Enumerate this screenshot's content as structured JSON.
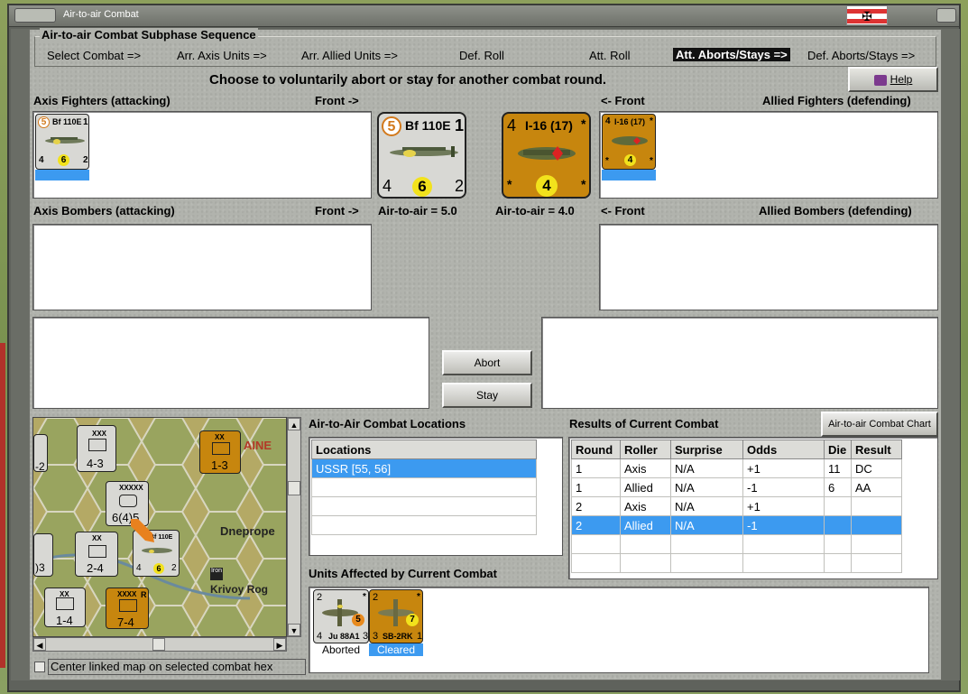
{
  "window": {
    "title": "Air-to-air Combat"
  },
  "sequence": {
    "title": "Air-to-air Combat Subphase Sequence",
    "steps": [
      "Select Combat =>",
      "Arr. Axis Units =>",
      "Arr. Allied Units =>",
      "Def. Roll",
      "Att. Roll",
      "Att. Aborts/Stays =>",
      "Def. Aborts/Stays =>"
    ]
  },
  "instruction": "Choose to voluntarily abort or stay for another combat round.",
  "help_label": "Help",
  "axis_fighters": {
    "label": "Axis Fighters (attacking)",
    "front_label": "Front ->"
  },
  "allied_fighters": {
    "label": "Allied Fighters (defending)",
    "front_label": "<- Front"
  },
  "axis_bombers": {
    "label": "Axis Bombers (attacking)",
    "front_label": "Front ->"
  },
  "allied_bombers": {
    "label": "Allied Bombers (defending)",
    "front_label": "<- Front"
  },
  "axis_air_to_air": "Air-to-air = 5.0",
  "allied_air_to_air": "Air-to-air = 4.0",
  "axis_unit": {
    "name": "Bf 110E",
    "cost": "5",
    "top_right": "1",
    "attack": "4",
    "range": "6",
    "defense": "2"
  },
  "allied_unit": {
    "name": "I-16 (17)",
    "top_left": "4",
    "top_right": "*",
    "range": "4",
    "bottom_left": "*",
    "bottom_right": "*"
  },
  "buttons": {
    "abort": "Abort",
    "stay": "Stay",
    "chart": "Air-to-air Combat Chart"
  },
  "locations": {
    "title": "Air-to-Air Combat Locations",
    "header": "Locations",
    "rows": [
      "USSR [55, 56]"
    ]
  },
  "results": {
    "title": "Results of Current Combat",
    "headers": [
      "Round",
      "Roller",
      "Surprise",
      "Odds",
      "Die",
      "Result"
    ],
    "rows": [
      [
        "1",
        "Axis",
        "N/A",
        "+1",
        "11",
        "DC"
      ],
      [
        "1",
        "Allied",
        "N/A",
        "-1",
        "6",
        "AA"
      ],
      [
        "2",
        "Axis",
        "N/A",
        "+1",
        "",
        ""
      ],
      [
        "2",
        "Allied",
        "N/A",
        "-1",
        "",
        ""
      ]
    ],
    "selected_row": 3
  },
  "affected": {
    "title": "Units Affected by Current Combat",
    "units": [
      {
        "name": "Ju 88A1",
        "top_left": "2",
        "top_right": "*",
        "range": "5",
        "bottom_left": "4",
        "bottom_right": "3",
        "status": "Aborted"
      },
      {
        "name": "SB-2RK",
        "top_left": "2",
        "top_right": "*",
        "range": "7",
        "bottom_left": "3",
        "bottom_right": "1",
        "status": "Cleared"
      }
    ]
  },
  "minimap": {
    "labels": {
      "dnepro": "Dneprope",
      "krivoy": "Krivoy Rog",
      "aine": "AINE",
      "iron": "Iron"
    },
    "counters": [
      {
        "top": "XXX",
        "value": "4-3",
        "side_num": "3"
      },
      {
        "top": "XX",
        "value": "1-3",
        "side_num": "2"
      },
      {
        "top": "XXXXX",
        "value": "6(4)5",
        "side_num": "3"
      },
      {
        "top": "XX",
        "value": "2-4",
        "side_num": "3"
      },
      {
        "top": "XX",
        "value": "1-4",
        "side_num": "3"
      },
      {
        "top": "XXXX",
        "value": "7-4",
        "side_num": "2",
        "tag": "R"
      },
      {
        "top": "",
        "value": "-2",
        "side_num": ""
      },
      {
        "top": "",
        "value": ")3",
        "side_num": ""
      }
    ],
    "stack_counter": {
      "name": "Bf 110E",
      "cost": "5",
      "attack": "4",
      "range": "6",
      "defense": "2",
      "side_num": "5"
    },
    "checkbox_label": "Center linked map on selected combat hex"
  },
  "colors": {
    "selection": "#3c9af0",
    "allied_counter": "#c7860e",
    "axis_counter": "#d8d8d4"
  }
}
